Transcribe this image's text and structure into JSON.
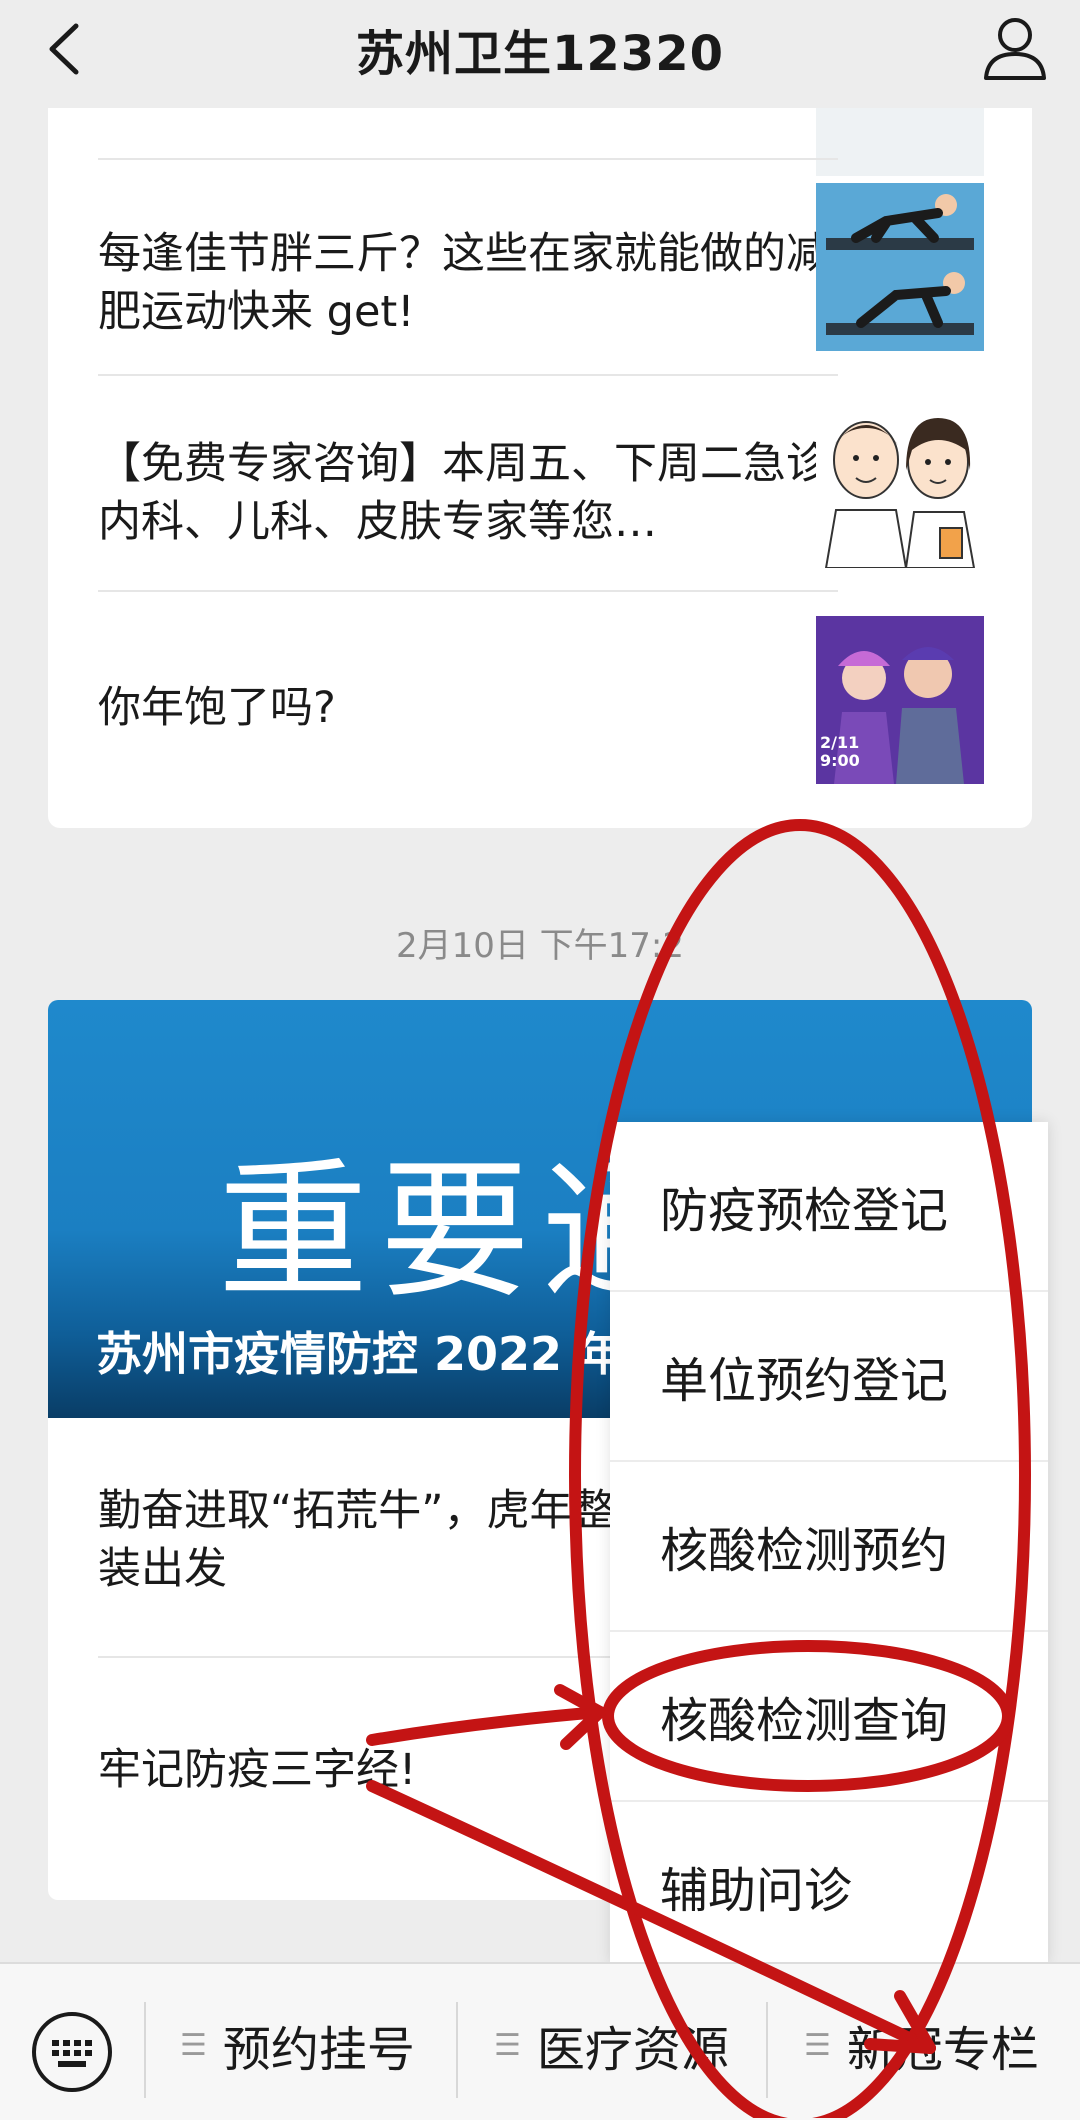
{
  "header": {
    "title": "苏州卫生12320",
    "back_icon": "chevron-left-icon",
    "profile_icon": "person-icon"
  },
  "articles_top": [
    {
      "title": "每逢佳节胖三斤？这些在家就能做的减肥运动快来 get!"
    },
    {
      "title": "【免费专家咨询】本周五、下周二急诊内科、儿科、皮肤专家等您…"
    },
    {
      "title": "你年饱了吗?",
      "thumb_date": "2/11",
      "thumb_time": "9:00"
    }
  ],
  "timestamp": "2月10日 下午17:2",
  "banner": {
    "big_text": "重要通",
    "sub_text": "苏州市疫情防控 2022 年"
  },
  "articles_bottom": [
    {
      "title": "勤奋进取“拓荒牛”，虎年整装出发"
    },
    {
      "title": "牢记防疫三字经!"
    }
  ],
  "popup_menu": {
    "items": [
      "防疫预检登记",
      "单位预约登记",
      "核酸检测预约",
      "核酸检测查询",
      "辅助问诊"
    ]
  },
  "bottom_bar": {
    "keyboard_icon": "keyboard-icon",
    "menus": [
      "预约挂号",
      "医疗资源",
      "新冠专栏"
    ]
  },
  "colors": {
    "banner_blue": "#1f89cc",
    "annotation_red": "#c41414",
    "background": "#ededed"
  }
}
